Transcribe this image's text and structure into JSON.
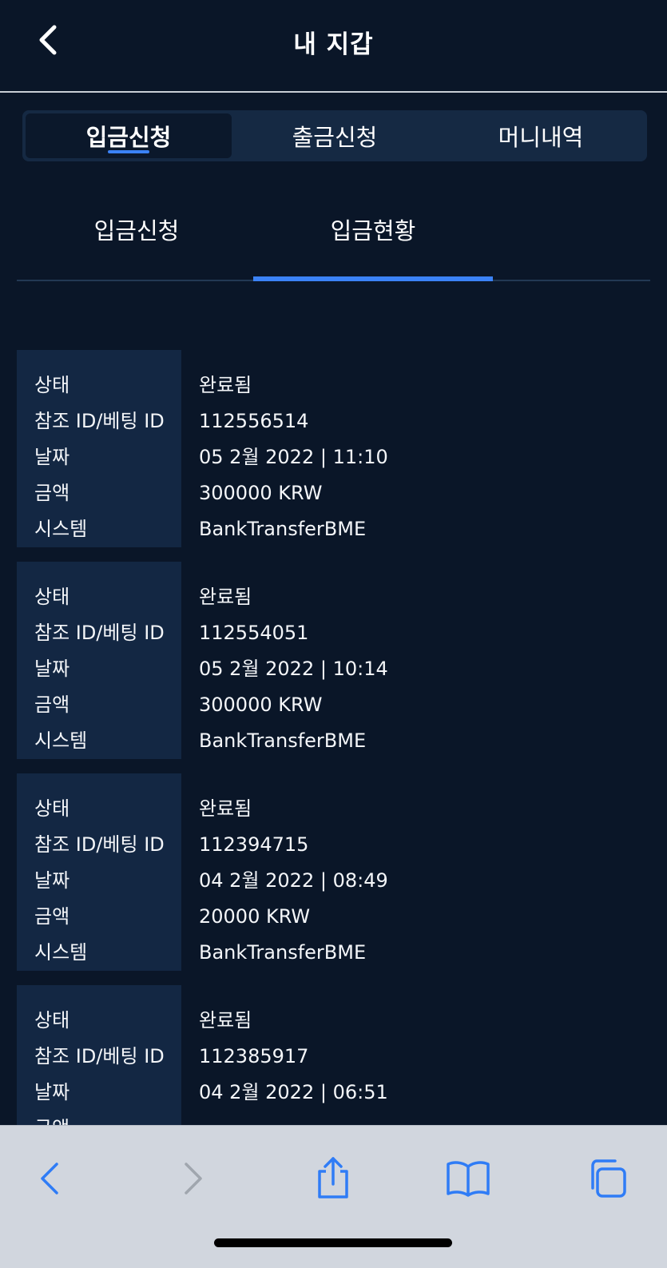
{
  "header": {
    "title": "내 지갑"
  },
  "main_tabs": [
    {
      "label": "입금신청",
      "active": true
    },
    {
      "label": "출금신청",
      "active": false
    },
    {
      "label": "머니내역",
      "active": false
    }
  ],
  "sub_tabs": [
    {
      "label": "입금신청",
      "active": false
    },
    {
      "label": "입금현황",
      "active": true
    }
  ],
  "field_labels": {
    "status": "상태",
    "ref_id": "참조 ID/베팅 ID",
    "date": "날짜",
    "amount": "금액",
    "system": "시스템"
  },
  "records": [
    {
      "status": "완료됨",
      "ref_id": "112556514",
      "date": "05 2월 2022 | 11:10",
      "amount": "300000 KRW",
      "system": "BankTransferBME"
    },
    {
      "status": "완료됨",
      "ref_id": "112554051",
      "date": "05 2월 2022 | 10:14",
      "amount": "300000 KRW",
      "system": "BankTransferBME"
    },
    {
      "status": "완료됨",
      "ref_id": "112394715",
      "date": "04 2월 2022 | 08:49",
      "amount": "20000 KRW",
      "system": "BankTransferBME"
    },
    {
      "status": "완료됨",
      "ref_id": "112385917",
      "date": "04 2월 2022 | 06:51",
      "amount": "",
      "system": ""
    }
  ],
  "icons": {
    "header_back": "chevron-left-icon",
    "browser_back": "chevron-left-icon",
    "browser_forward": "chevron-right-icon",
    "share": "share-icon",
    "bookmarks": "book-icon",
    "tabs": "tabs-icon"
  },
  "colors": {
    "background": "#0a1628",
    "panel": "#132743",
    "accent": "#3b82f6",
    "browser_bar": "#d1d6de",
    "browser_icon": "#2f7cf6",
    "browser_icon_disabled": "#a0a6ae"
  }
}
